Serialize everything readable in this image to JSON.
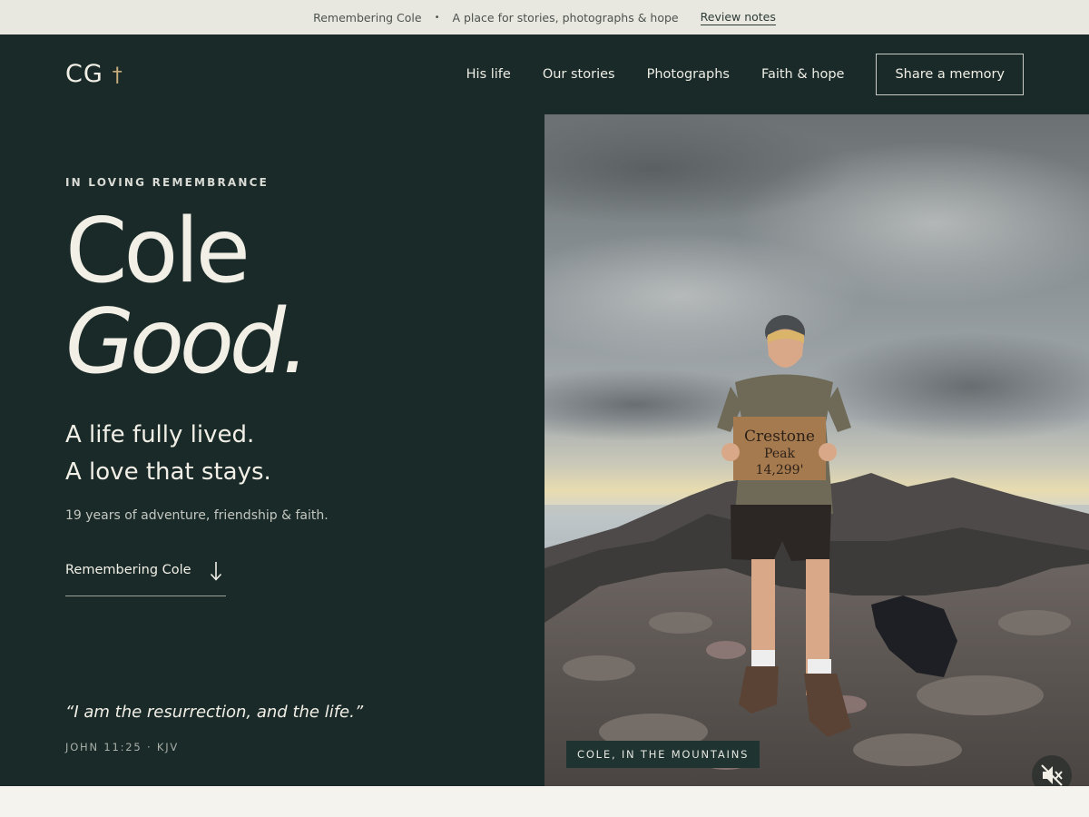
{
  "banner": {
    "title": "Remembering Cole",
    "separator": "•",
    "tagline": "A place for stories, photographs & hope",
    "link": "Review notes"
  },
  "nav": {
    "logo": "CG",
    "logo_mark": "†",
    "items": [
      "His life",
      "Our stories",
      "Photographs",
      "Faith & hope"
    ],
    "cta": "Share a memory"
  },
  "hero": {
    "eyebrow": "IN LOVING REMEMBRANCE",
    "first_name": "Cole",
    "last_name": "Good.",
    "tagline_1": "A life fully lived.",
    "tagline_2": "A love that stays.",
    "subtitle": "19 years of adventure, friendship & faith.",
    "scroll_link": "Remembering Cole",
    "quote": "“I am the resurrection, and the life.”",
    "citation": "JOHN 11:25 · KJV"
  },
  "photo": {
    "sign_lines": [
      "Crestone",
      "Peak",
      "14,299'"
    ],
    "caption": "COLE, IN THE MOUNTAINS",
    "mute_icon": "speaker-muted-icon"
  },
  "colors": {
    "hero_bg": "#1a2a29",
    "banner_bg": "#e8e8e1",
    "accent_cross": "#c9ad7c",
    "page_bg": "#f4f3ee"
  }
}
